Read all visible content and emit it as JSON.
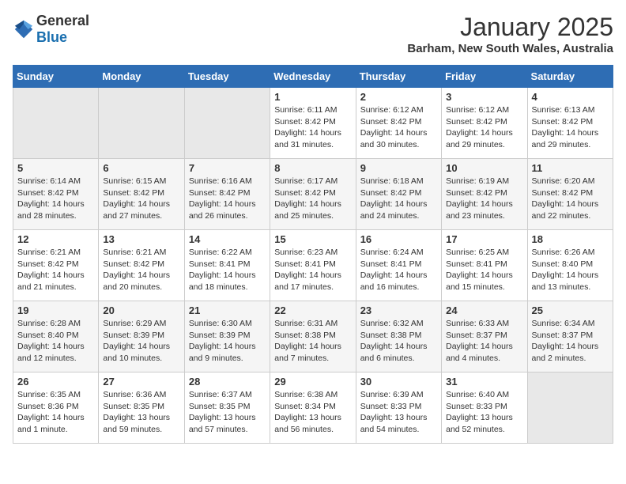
{
  "header": {
    "logo_general": "General",
    "logo_blue": "Blue",
    "month_title": "January 2025",
    "location": "Barham, New South Wales, Australia"
  },
  "days_of_week": [
    "Sunday",
    "Monday",
    "Tuesday",
    "Wednesday",
    "Thursday",
    "Friday",
    "Saturday"
  ],
  "weeks": [
    [
      {
        "day": "",
        "info": ""
      },
      {
        "day": "",
        "info": ""
      },
      {
        "day": "",
        "info": ""
      },
      {
        "day": "1",
        "info": "Sunrise: 6:11 AM\nSunset: 8:42 PM\nDaylight: 14 hours and 31 minutes."
      },
      {
        "day": "2",
        "info": "Sunrise: 6:12 AM\nSunset: 8:42 PM\nDaylight: 14 hours and 30 minutes."
      },
      {
        "day": "3",
        "info": "Sunrise: 6:12 AM\nSunset: 8:42 PM\nDaylight: 14 hours and 29 minutes."
      },
      {
        "day": "4",
        "info": "Sunrise: 6:13 AM\nSunset: 8:42 PM\nDaylight: 14 hours and 29 minutes."
      }
    ],
    [
      {
        "day": "5",
        "info": "Sunrise: 6:14 AM\nSunset: 8:42 PM\nDaylight: 14 hours and 28 minutes."
      },
      {
        "day": "6",
        "info": "Sunrise: 6:15 AM\nSunset: 8:42 PM\nDaylight: 14 hours and 27 minutes."
      },
      {
        "day": "7",
        "info": "Sunrise: 6:16 AM\nSunset: 8:42 PM\nDaylight: 14 hours and 26 minutes."
      },
      {
        "day": "8",
        "info": "Sunrise: 6:17 AM\nSunset: 8:42 PM\nDaylight: 14 hours and 25 minutes."
      },
      {
        "day": "9",
        "info": "Sunrise: 6:18 AM\nSunset: 8:42 PM\nDaylight: 14 hours and 24 minutes."
      },
      {
        "day": "10",
        "info": "Sunrise: 6:19 AM\nSunset: 8:42 PM\nDaylight: 14 hours and 23 minutes."
      },
      {
        "day": "11",
        "info": "Sunrise: 6:20 AM\nSunset: 8:42 PM\nDaylight: 14 hours and 22 minutes."
      }
    ],
    [
      {
        "day": "12",
        "info": "Sunrise: 6:21 AM\nSunset: 8:42 PM\nDaylight: 14 hours and 21 minutes."
      },
      {
        "day": "13",
        "info": "Sunrise: 6:21 AM\nSunset: 8:42 PM\nDaylight: 14 hours and 20 minutes."
      },
      {
        "day": "14",
        "info": "Sunrise: 6:22 AM\nSunset: 8:41 PM\nDaylight: 14 hours and 18 minutes."
      },
      {
        "day": "15",
        "info": "Sunrise: 6:23 AM\nSunset: 8:41 PM\nDaylight: 14 hours and 17 minutes."
      },
      {
        "day": "16",
        "info": "Sunrise: 6:24 AM\nSunset: 8:41 PM\nDaylight: 14 hours and 16 minutes."
      },
      {
        "day": "17",
        "info": "Sunrise: 6:25 AM\nSunset: 8:41 PM\nDaylight: 14 hours and 15 minutes."
      },
      {
        "day": "18",
        "info": "Sunrise: 6:26 AM\nSunset: 8:40 PM\nDaylight: 14 hours and 13 minutes."
      }
    ],
    [
      {
        "day": "19",
        "info": "Sunrise: 6:28 AM\nSunset: 8:40 PM\nDaylight: 14 hours and 12 minutes."
      },
      {
        "day": "20",
        "info": "Sunrise: 6:29 AM\nSunset: 8:39 PM\nDaylight: 14 hours and 10 minutes."
      },
      {
        "day": "21",
        "info": "Sunrise: 6:30 AM\nSunset: 8:39 PM\nDaylight: 14 hours and 9 minutes."
      },
      {
        "day": "22",
        "info": "Sunrise: 6:31 AM\nSunset: 8:38 PM\nDaylight: 14 hours and 7 minutes."
      },
      {
        "day": "23",
        "info": "Sunrise: 6:32 AM\nSunset: 8:38 PM\nDaylight: 14 hours and 6 minutes."
      },
      {
        "day": "24",
        "info": "Sunrise: 6:33 AM\nSunset: 8:37 PM\nDaylight: 14 hours and 4 minutes."
      },
      {
        "day": "25",
        "info": "Sunrise: 6:34 AM\nSunset: 8:37 PM\nDaylight: 14 hours and 2 minutes."
      }
    ],
    [
      {
        "day": "26",
        "info": "Sunrise: 6:35 AM\nSunset: 8:36 PM\nDaylight: 14 hours and 1 minute."
      },
      {
        "day": "27",
        "info": "Sunrise: 6:36 AM\nSunset: 8:35 PM\nDaylight: 13 hours and 59 minutes."
      },
      {
        "day": "28",
        "info": "Sunrise: 6:37 AM\nSunset: 8:35 PM\nDaylight: 13 hours and 57 minutes."
      },
      {
        "day": "29",
        "info": "Sunrise: 6:38 AM\nSunset: 8:34 PM\nDaylight: 13 hours and 56 minutes."
      },
      {
        "day": "30",
        "info": "Sunrise: 6:39 AM\nSunset: 8:33 PM\nDaylight: 13 hours and 54 minutes."
      },
      {
        "day": "31",
        "info": "Sunrise: 6:40 AM\nSunset: 8:33 PM\nDaylight: 13 hours and 52 minutes."
      },
      {
        "day": "",
        "info": ""
      }
    ]
  ]
}
